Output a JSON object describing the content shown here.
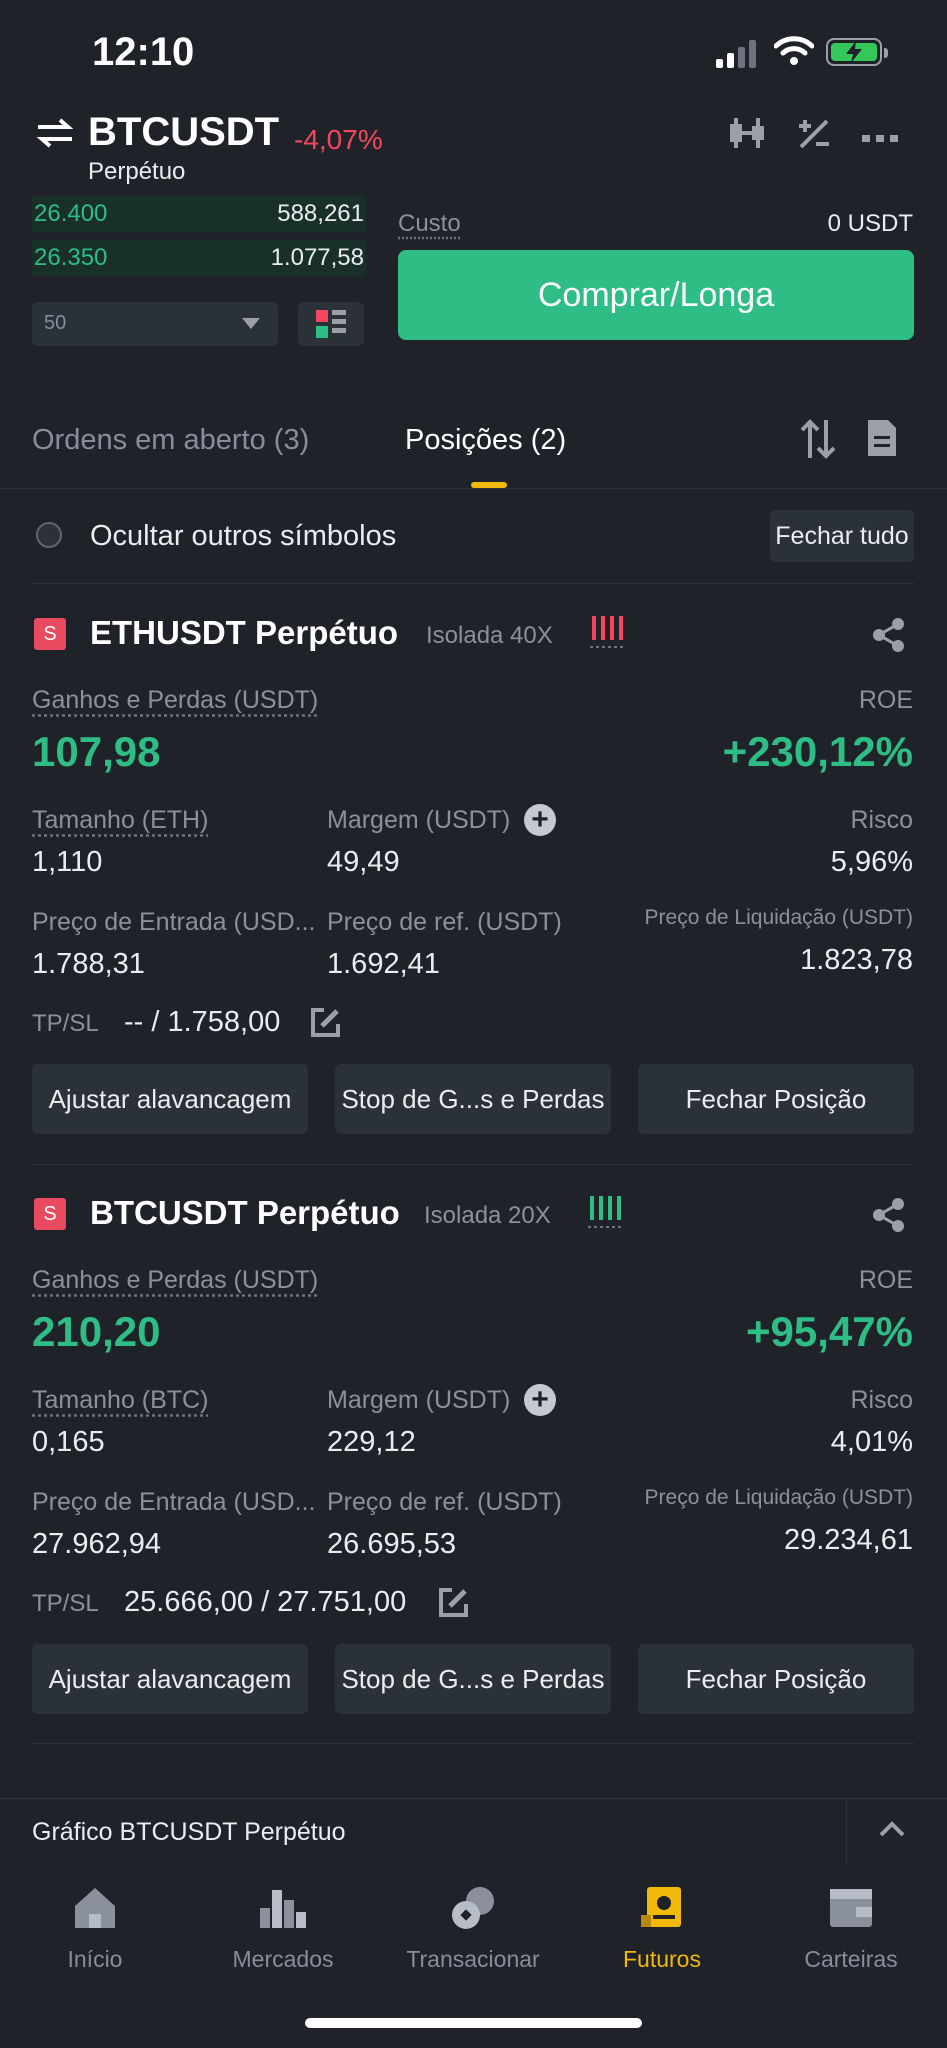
{
  "status_bar": {
    "time": "12:10"
  },
  "header": {
    "pair": "BTCUSDT",
    "change": "-4,07%",
    "contract": "Perpétuo"
  },
  "orderbook": {
    "rows": [
      {
        "price": "26.400",
        "qty": "588,261"
      },
      {
        "price": "26.350",
        "qty": "1.077,58"
      }
    ],
    "depth": "50"
  },
  "order_panel": {
    "cost_label": "Custo",
    "cost_value": "0 USDT",
    "buy_label": "Comprar/Longa"
  },
  "tabs": {
    "open_orders": "Ordens em aberto (3)",
    "positions": "Posições (2)"
  },
  "filter": {
    "hide_label": "Ocultar outros símbolos",
    "close_all": "Fechar tudo"
  },
  "positions": [
    {
      "side_badge": "S",
      "title": "ETHUSDT Perpétuo",
      "margin_mode": "Isolada 40X",
      "risk_color": "#f6465d",
      "pnl_label": "Ganhos e Perdas (USDT)",
      "pnl": "107,98",
      "roe_label": "ROE",
      "roe": "+230,12%",
      "size_label": "Tamanho (ETH)",
      "size": "1,110",
      "margin_label": "Margem (USDT)",
      "margin": "49,49",
      "risk_label": "Risco",
      "risk": "5,96%",
      "entry_label": "Preço de Entrada (USD...",
      "entry": "1.788,31",
      "mark_label": "Preço de ref. (USDT)",
      "mark": "1.692,41",
      "liq_label": "Preço de Liquidação (USDT)",
      "liq": "1.823,78",
      "tpsl_label": "TP/SL",
      "tpsl": "-- / 1.758,00",
      "btn_leverage": "Ajustar alavancagem",
      "btn_stop": "Stop de G...s e Perdas",
      "btn_close": "Fechar Posição"
    },
    {
      "side_badge": "S",
      "title": "BTCUSDT Perpétuo",
      "margin_mode": "Isolada 20X",
      "risk_color": "#2ebd85",
      "pnl_label": "Ganhos e Perdas (USDT)",
      "pnl": "210,20",
      "roe_label": "ROE",
      "roe": "+95,47%",
      "size_label": "Tamanho (BTC)",
      "size": "0,165",
      "margin_label": "Margem (USDT)",
      "margin": "229,12",
      "risk_label": "Risco",
      "risk": "4,01%",
      "entry_label": "Preço de Entrada (USD...",
      "entry": "27.962,94",
      "mark_label": "Preço de ref. (USDT)",
      "mark": "26.695,53",
      "liq_label": "Preço de Liquidação (USDT)",
      "liq": "29.234,61",
      "tpsl_label": "TP/SL",
      "tpsl": "25.666,00 / 27.751,00",
      "btn_leverage": "Ajustar alavancagem",
      "btn_stop": "Stop de G...s e Perdas",
      "btn_close": "Fechar Posição"
    }
  ],
  "chart_bar": {
    "label": "Gráfico BTCUSDT Perpétuo"
  },
  "nav": {
    "items": [
      {
        "label": "Início",
        "icon": "home-icon"
      },
      {
        "label": "Mercados",
        "icon": "markets-icon"
      },
      {
        "label": "Transacionar",
        "icon": "trade-icon"
      },
      {
        "label": "Futuros",
        "icon": "futures-icon"
      },
      {
        "label": "Carteiras",
        "icon": "wallet-icon"
      }
    ],
    "active_index": 3
  },
  "colors": {
    "background": "#1f2329",
    "green": "#2ebd85",
    "red": "#f6465d",
    "accent": "#f0b90b"
  }
}
